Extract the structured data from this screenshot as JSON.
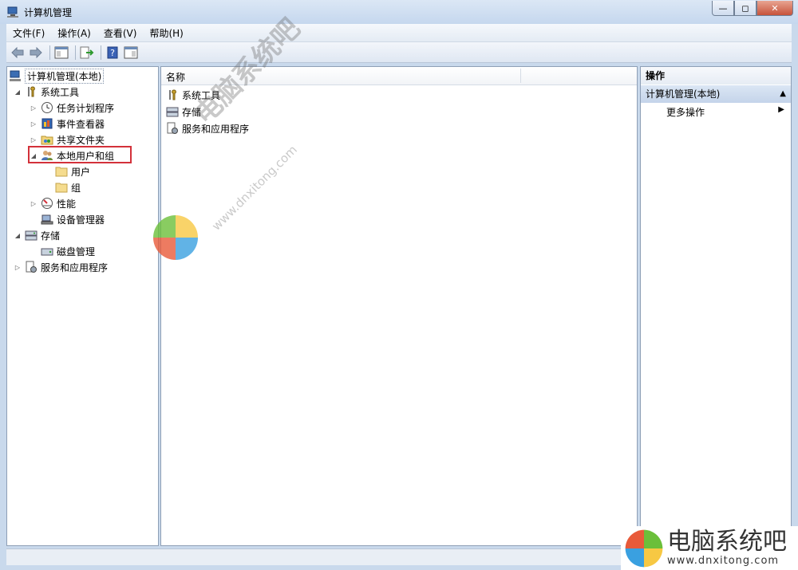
{
  "window": {
    "title": "计算机管理",
    "btn_min": "▭",
    "btn_max": "□",
    "btn_close": "✕"
  },
  "menubar": [
    "文件(F)",
    "操作(A)",
    "查看(V)",
    "帮助(H)"
  ],
  "tree": {
    "root": "计算机管理(本地)",
    "system_tools": "系统工具",
    "task_scheduler": "任务计划程序",
    "event_viewer": "事件查看器",
    "shared_folders": "共享文件夹",
    "local_users_groups": "本地用户和组",
    "users": "用户",
    "groups": "组",
    "performance": "性能",
    "device_manager": "设备管理器",
    "storage": "存储",
    "disk_management": "磁盘管理",
    "services_apps": "服务和应用程序"
  },
  "center": {
    "column_name": "名称",
    "items": [
      "系统工具",
      "存储",
      "服务和应用程序"
    ]
  },
  "actions": {
    "header": "操作",
    "section": "计算机管理(本地)",
    "more": "更多操作"
  },
  "watermark": {
    "text": "电脑系统吧",
    "url": "www.dnxitong.com"
  },
  "colors": {
    "highlight": "#d3313a",
    "selection": "#c4d4ea"
  }
}
